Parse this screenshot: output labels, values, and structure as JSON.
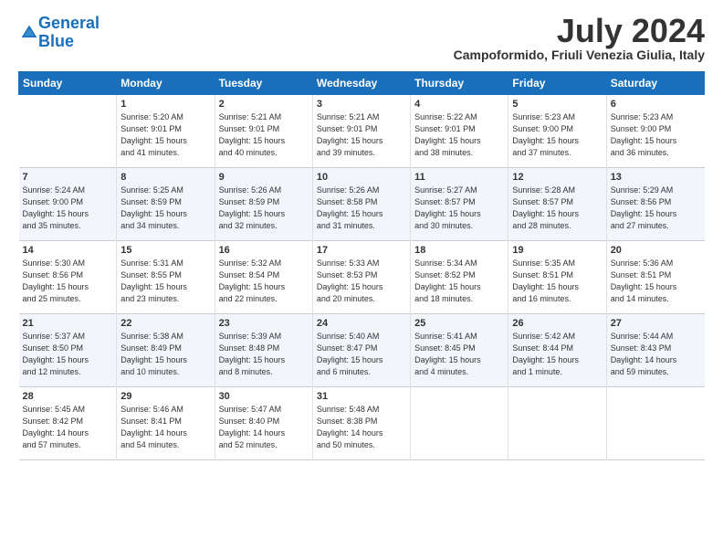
{
  "logo": {
    "line1": "General",
    "line2": "Blue"
  },
  "title": "July 2024",
  "location": "Campoformido, Friuli Venezia Giulia, Italy",
  "days_of_week": [
    "Sunday",
    "Monday",
    "Tuesday",
    "Wednesday",
    "Thursday",
    "Friday",
    "Saturday"
  ],
  "weeks": [
    [
      {
        "day": "",
        "text": ""
      },
      {
        "day": "1",
        "text": "Sunrise: 5:20 AM\nSunset: 9:01 PM\nDaylight: 15 hours\nand 41 minutes."
      },
      {
        "day": "2",
        "text": "Sunrise: 5:21 AM\nSunset: 9:01 PM\nDaylight: 15 hours\nand 40 minutes."
      },
      {
        "day": "3",
        "text": "Sunrise: 5:21 AM\nSunset: 9:01 PM\nDaylight: 15 hours\nand 39 minutes."
      },
      {
        "day": "4",
        "text": "Sunrise: 5:22 AM\nSunset: 9:01 PM\nDaylight: 15 hours\nand 38 minutes."
      },
      {
        "day": "5",
        "text": "Sunrise: 5:23 AM\nSunset: 9:00 PM\nDaylight: 15 hours\nand 37 minutes."
      },
      {
        "day": "6",
        "text": "Sunrise: 5:23 AM\nSunset: 9:00 PM\nDaylight: 15 hours\nand 36 minutes."
      }
    ],
    [
      {
        "day": "7",
        "text": "Sunrise: 5:24 AM\nSunset: 9:00 PM\nDaylight: 15 hours\nand 35 minutes."
      },
      {
        "day": "8",
        "text": "Sunrise: 5:25 AM\nSunset: 8:59 PM\nDaylight: 15 hours\nand 34 minutes."
      },
      {
        "day": "9",
        "text": "Sunrise: 5:26 AM\nSunset: 8:59 PM\nDaylight: 15 hours\nand 32 minutes."
      },
      {
        "day": "10",
        "text": "Sunrise: 5:26 AM\nSunset: 8:58 PM\nDaylight: 15 hours\nand 31 minutes."
      },
      {
        "day": "11",
        "text": "Sunrise: 5:27 AM\nSunset: 8:57 PM\nDaylight: 15 hours\nand 30 minutes."
      },
      {
        "day": "12",
        "text": "Sunrise: 5:28 AM\nSunset: 8:57 PM\nDaylight: 15 hours\nand 28 minutes."
      },
      {
        "day": "13",
        "text": "Sunrise: 5:29 AM\nSunset: 8:56 PM\nDaylight: 15 hours\nand 27 minutes."
      }
    ],
    [
      {
        "day": "14",
        "text": "Sunrise: 5:30 AM\nSunset: 8:56 PM\nDaylight: 15 hours\nand 25 minutes."
      },
      {
        "day": "15",
        "text": "Sunrise: 5:31 AM\nSunset: 8:55 PM\nDaylight: 15 hours\nand 23 minutes."
      },
      {
        "day": "16",
        "text": "Sunrise: 5:32 AM\nSunset: 8:54 PM\nDaylight: 15 hours\nand 22 minutes."
      },
      {
        "day": "17",
        "text": "Sunrise: 5:33 AM\nSunset: 8:53 PM\nDaylight: 15 hours\nand 20 minutes."
      },
      {
        "day": "18",
        "text": "Sunrise: 5:34 AM\nSunset: 8:52 PM\nDaylight: 15 hours\nand 18 minutes."
      },
      {
        "day": "19",
        "text": "Sunrise: 5:35 AM\nSunset: 8:51 PM\nDaylight: 15 hours\nand 16 minutes."
      },
      {
        "day": "20",
        "text": "Sunrise: 5:36 AM\nSunset: 8:51 PM\nDaylight: 15 hours\nand 14 minutes."
      }
    ],
    [
      {
        "day": "21",
        "text": "Sunrise: 5:37 AM\nSunset: 8:50 PM\nDaylight: 15 hours\nand 12 minutes."
      },
      {
        "day": "22",
        "text": "Sunrise: 5:38 AM\nSunset: 8:49 PM\nDaylight: 15 hours\nand 10 minutes."
      },
      {
        "day": "23",
        "text": "Sunrise: 5:39 AM\nSunset: 8:48 PM\nDaylight: 15 hours\nand 8 minutes."
      },
      {
        "day": "24",
        "text": "Sunrise: 5:40 AM\nSunset: 8:47 PM\nDaylight: 15 hours\nand 6 minutes."
      },
      {
        "day": "25",
        "text": "Sunrise: 5:41 AM\nSunset: 8:45 PM\nDaylight: 15 hours\nand 4 minutes."
      },
      {
        "day": "26",
        "text": "Sunrise: 5:42 AM\nSunset: 8:44 PM\nDaylight: 15 hours\nand 1 minute."
      },
      {
        "day": "27",
        "text": "Sunrise: 5:44 AM\nSunset: 8:43 PM\nDaylight: 14 hours\nand 59 minutes."
      }
    ],
    [
      {
        "day": "28",
        "text": "Sunrise: 5:45 AM\nSunset: 8:42 PM\nDaylight: 14 hours\nand 57 minutes."
      },
      {
        "day": "29",
        "text": "Sunrise: 5:46 AM\nSunset: 8:41 PM\nDaylight: 14 hours\nand 54 minutes."
      },
      {
        "day": "30",
        "text": "Sunrise: 5:47 AM\nSunset: 8:40 PM\nDaylight: 14 hours\nand 52 minutes."
      },
      {
        "day": "31",
        "text": "Sunrise: 5:48 AM\nSunset: 8:38 PM\nDaylight: 14 hours\nand 50 minutes."
      },
      {
        "day": "",
        "text": ""
      },
      {
        "day": "",
        "text": ""
      },
      {
        "day": "",
        "text": ""
      }
    ]
  ]
}
